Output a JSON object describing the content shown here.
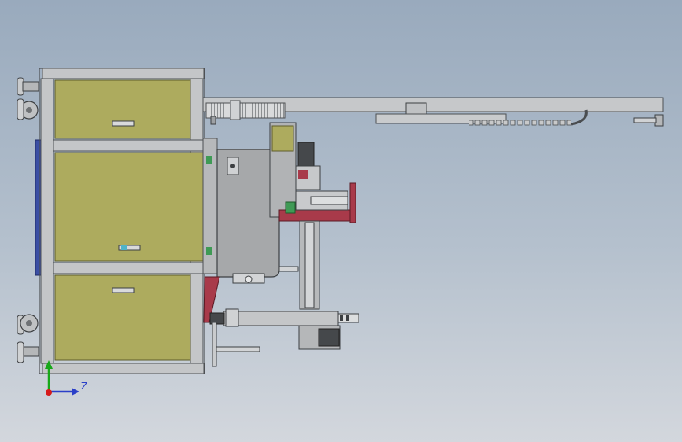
{
  "viewport": {
    "background_top": "#99aabd",
    "background_bottom": "#d3d7dd"
  },
  "colors": {
    "frame_steel": "#c4c6c8",
    "frame_edge": "#4d5053",
    "panel_olive": "#adab5e",
    "panel_olive_dark": "#8e8c45",
    "side_blue": "#3a4ea3",
    "accent_red": "#a83a4a",
    "machined_grey": "#a6a8aa",
    "dark_metal": "#45484b",
    "axis_x": "#d61a1a",
    "axis_y": "#18a81a",
    "axis_z": "#2a3fc8"
  },
  "axis_triad": {
    "z_label": "Z",
    "icons": [
      "y-axis-arrow-icon",
      "z-axis-arrow-icon",
      "origin-dot-icon"
    ]
  }
}
